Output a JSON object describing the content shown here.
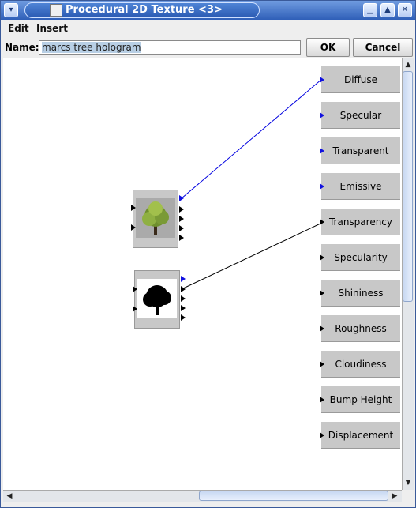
{
  "window": {
    "title": "Procedural 2D Texture <3>"
  },
  "menu": {
    "items": [
      "Edit",
      "Insert"
    ]
  },
  "name_row": {
    "label": "Name:",
    "value": "marcs tree hologram",
    "ok_label": "OK",
    "cancel_label": "Cancel"
  },
  "outputs": [
    "Diffuse",
    "Specular",
    "Transparent",
    "Emissive",
    "Transparency",
    "Specularity",
    "Shininess",
    "Roughness",
    "Cloudiness",
    "Bump Height",
    "Displacement"
  ],
  "nodes": [
    {
      "name": "image-node-color-tree",
      "connected_to": "Diffuse",
      "link_color": "#0000e0"
    },
    {
      "name": "image-node-black-tree",
      "connected_to": "Transparency",
      "link_color": "#000000"
    }
  ],
  "colors": {
    "title_bar": "#2f5fb8",
    "link_blue": "#0000e0",
    "panel_gray": "#c8c8c8"
  },
  "icons": {
    "window_menu": "chevron-down-icon",
    "app": "java-cup-icon",
    "minimize": "minimize-icon",
    "maximize": "maximize-icon",
    "close": "close-icon"
  }
}
